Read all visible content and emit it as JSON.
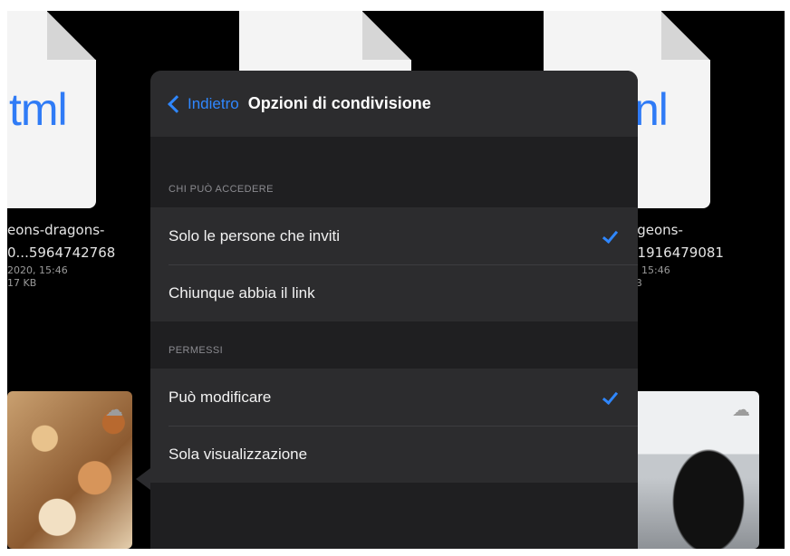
{
  "background_files": [
    {
      "ext_fragment": "tml",
      "name_line1": "eons-dragons-",
      "name_line2": "0...5964742768",
      "date": "2020, 15:46",
      "size": "17 KB"
    },
    {
      "ext_fragment": "",
      "name_line1": "",
      "name_line2": "",
      "date": "",
      "size": ""
    },
    {
      "ext_fragment": "nl",
      "name_line1": "ageons-",
      "name_line2": "31916479081",
      "date": "0, 15:46",
      "size": "KB"
    }
  ],
  "popover": {
    "back_label": "Indietro",
    "title": "Opzioni di condivisione",
    "sections": [
      {
        "header": "CHI PUÒ ACCEDERE",
        "options": [
          {
            "label": "Solo le persone che inviti",
            "selected": true
          },
          {
            "label": "Chiunque abbia il link",
            "selected": false
          }
        ]
      },
      {
        "header": "PERMESSI",
        "options": [
          {
            "label": "Può modificare",
            "selected": true
          },
          {
            "label": "Sola visualizzazione",
            "selected": false
          }
        ]
      }
    ]
  },
  "colors": {
    "accent": "#2f87ff",
    "sheet": "#2c2c2e",
    "backdrop": "#000000"
  },
  "icons": {
    "back": "chevron-left-icon",
    "check": "checkmark-icon",
    "cloud": "cloud-download-icon"
  }
}
